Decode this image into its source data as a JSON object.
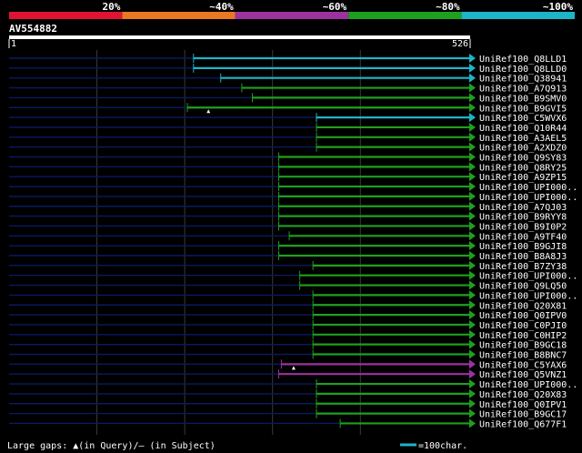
{
  "legend": {
    "labels": [
      "20%",
      "~40%",
      "~60%",
      "~80%",
      "~100%"
    ],
    "colors": [
      "#e01432",
      "#e87822",
      "#9b32a0",
      "#1ea01e",
      "#1eb4c8"
    ]
  },
  "query": {
    "id": "AV554882",
    "start_label": "1",
    "end_label": "526",
    "length": 526
  },
  "footer": {
    "large_gaps_text": "Large gaps: ▲(in Query)/– (in Subject)",
    "scale_text": "=100char."
  },
  "chart_data": {
    "type": "alignment",
    "query_length": 526,
    "hits": [
      {
        "name": "UniRef100_Q8LLD1",
        "start": 211,
        "end": 526,
        "color": "#1eb4c8",
        "gaps": []
      },
      {
        "name": "UniRef100_Q8LLD0",
        "start": 211,
        "end": 526,
        "color": "#1eb4c8",
        "gaps": []
      },
      {
        "name": "UniRef100_Q38941",
        "start": 242,
        "end": 526,
        "color": "#1eb4c8",
        "gaps": []
      },
      {
        "name": "UniRef100_A7Q913",
        "start": 266,
        "end": 526,
        "color": "#1ea01e",
        "gaps": []
      },
      {
        "name": "UniRef100_B9SMV0",
        "start": 278,
        "end": 526,
        "color": "#1ea01e",
        "gaps": []
      },
      {
        "name": "UniRef100_B9GVI5",
        "start": 204,
        "end": 526,
        "color": "#1ea01e",
        "gaps": [
          228
        ]
      },
      {
        "name": "UniRef100_C5WVX6",
        "start": 351,
        "end": 526,
        "color": "#1eb4c8",
        "gaps": []
      },
      {
        "name": "UniRef100_Q10R44",
        "start": 351,
        "end": 526,
        "color": "#1ea01e",
        "gaps": []
      },
      {
        "name": "UniRef100_A3AEL5",
        "start": 351,
        "end": 526,
        "color": "#1ea01e",
        "gaps": []
      },
      {
        "name": "UniRef100_A2XDZ0",
        "start": 351,
        "end": 526,
        "color": "#1ea01e",
        "gaps": []
      },
      {
        "name": "UniRef100_Q9SY83",
        "start": 308,
        "end": 526,
        "color": "#1ea01e",
        "gaps": []
      },
      {
        "name": "UniRef100_Q8RY25",
        "start": 308,
        "end": 526,
        "color": "#1ea01e",
        "gaps": []
      },
      {
        "name": "UniRef100_A9ZP15",
        "start": 308,
        "end": 526,
        "color": "#1ea01e",
        "gaps": []
      },
      {
        "name": "UniRef100_UPI000..",
        "start": 308,
        "end": 526,
        "color": "#1ea01e",
        "gaps": []
      },
      {
        "name": "UniRef100_UPI000..",
        "start": 308,
        "end": 526,
        "color": "#1ea01e",
        "gaps": []
      },
      {
        "name": "UniRef100_A7QJ03",
        "start": 308,
        "end": 526,
        "color": "#1ea01e",
        "gaps": []
      },
      {
        "name": "UniRef100_B9RYY8",
        "start": 308,
        "end": 526,
        "color": "#1ea01e",
        "gaps": []
      },
      {
        "name": "UniRef100_B9I0P2",
        "start": 308,
        "end": 526,
        "color": "#1ea01e",
        "gaps": []
      },
      {
        "name": "UniRef100_A9TF40",
        "start": 320,
        "end": 526,
        "color": "#1ea01e",
        "gaps": []
      },
      {
        "name": "UniRef100_B9GJI8",
        "start": 308,
        "end": 526,
        "color": "#1ea01e",
        "gaps": []
      },
      {
        "name": "UniRef100_B8A8J3",
        "start": 308,
        "end": 526,
        "color": "#1ea01e",
        "gaps": []
      },
      {
        "name": "UniRef100_B7ZY38",
        "start": 347,
        "end": 526,
        "color": "#1ea01e",
        "gaps": []
      },
      {
        "name": "UniRef100_UPI000..",
        "start": 332,
        "end": 526,
        "color": "#1ea01e",
        "gaps": []
      },
      {
        "name": "UniRef100_Q9LQ50",
        "start": 332,
        "end": 526,
        "color": "#1ea01e",
        "gaps": []
      },
      {
        "name": "UniRef100_UPI000..",
        "start": 347,
        "end": 526,
        "color": "#1ea01e",
        "gaps": []
      },
      {
        "name": "UniRef100_Q20X81",
        "start": 347,
        "end": 526,
        "color": "#1ea01e",
        "gaps": []
      },
      {
        "name": "UniRef100_Q0IPV0",
        "start": 347,
        "end": 526,
        "color": "#1ea01e",
        "gaps": []
      },
      {
        "name": "UniRef100_C0PJI0",
        "start": 347,
        "end": 526,
        "color": "#1ea01e",
        "gaps": []
      },
      {
        "name": "UniRef100_C0HIP2",
        "start": 347,
        "end": 526,
        "color": "#1ea01e",
        "gaps": []
      },
      {
        "name": "UniRef100_B9GC18",
        "start": 347,
        "end": 526,
        "color": "#1ea01e",
        "gaps": []
      },
      {
        "name": "UniRef100_B8BNC7",
        "start": 347,
        "end": 526,
        "color": "#1ea01e",
        "gaps": []
      },
      {
        "name": "UniRef100_C5YAX6",
        "start": 311,
        "end": 526,
        "color": "#9b32a0",
        "gaps": [
          325
        ]
      },
      {
        "name": "UniRef100_Q5VNZ1",
        "start": 308,
        "end": 526,
        "color": "#9b32a0",
        "gaps": []
      },
      {
        "name": "UniRef100_UPI000..",
        "start": 351,
        "end": 526,
        "color": "#1ea01e",
        "gaps": []
      },
      {
        "name": "UniRef100_Q20X83",
        "start": 351,
        "end": 526,
        "color": "#1ea01e",
        "gaps": []
      },
      {
        "name": "UniRef100_Q0IPV1",
        "start": 351,
        "end": 526,
        "color": "#1ea01e",
        "gaps": []
      },
      {
        "name": "UniRef100_B9GC17",
        "start": 351,
        "end": 526,
        "color": "#1ea01e",
        "gaps": []
      },
      {
        "name": "UniRef100_Q677F1",
        "start": 378,
        "end": 526,
        "color": "#1ea01e",
        "gaps": []
      }
    ]
  }
}
